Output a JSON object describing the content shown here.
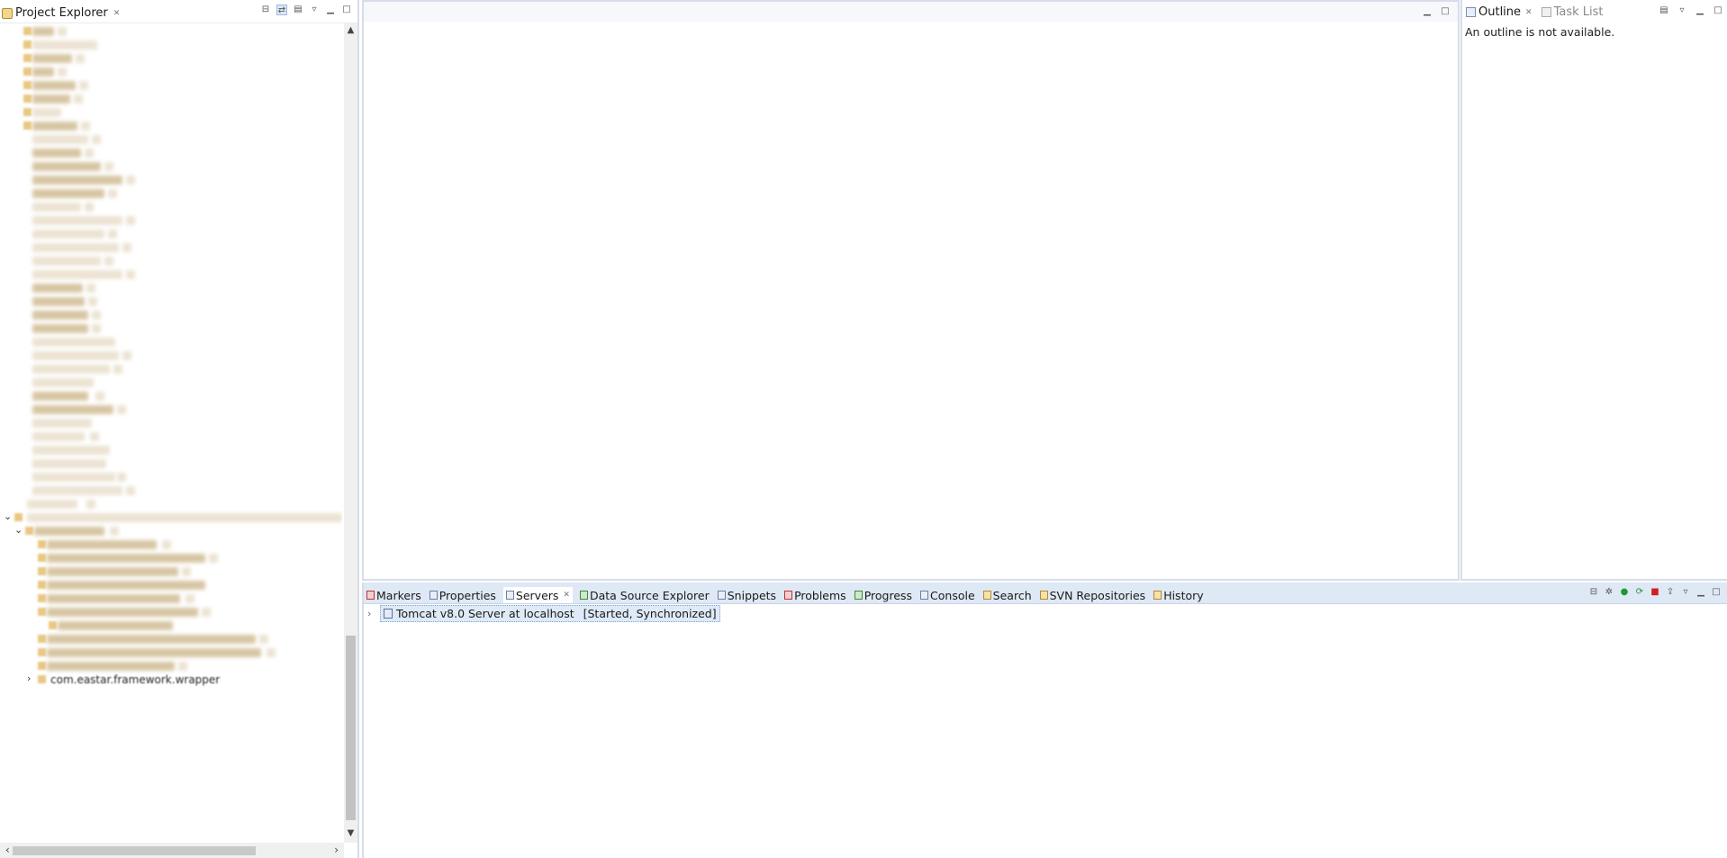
{
  "project_explorer": {
    "tab_label": "Project Explorer",
    "tree_partial_visible_text": "com.eastar.framework.wrapper"
  },
  "outline": {
    "tabs": [
      {
        "label": "Outline",
        "active": true
      },
      {
        "label": "Task List",
        "active": false
      }
    ],
    "message": "An outline is not available."
  },
  "bottom_views": {
    "tabs": [
      {
        "label": "Markers",
        "icon": "markers-icon",
        "active": false
      },
      {
        "label": "Properties",
        "icon": "properties-icon",
        "active": false
      },
      {
        "label": "Servers",
        "icon": "servers-icon",
        "active": true
      },
      {
        "label": "Data Source Explorer",
        "icon": "data-source-icon",
        "active": false
      },
      {
        "label": "Snippets",
        "icon": "snippets-icon",
        "active": false
      },
      {
        "label": "Problems",
        "icon": "problems-icon",
        "active": false
      },
      {
        "label": "Progress",
        "icon": "progress-icon",
        "active": false
      },
      {
        "label": "Console",
        "icon": "console-icon",
        "active": false
      },
      {
        "label": "Search",
        "icon": "search-icon",
        "active": false
      },
      {
        "label": "SVN Repositories",
        "icon": "svn-icon",
        "active": false
      },
      {
        "label": "History",
        "icon": "history-icon",
        "active": false
      }
    ],
    "servers": [
      {
        "name": "Tomcat v8.0 Server at localhost",
        "status": "[Started, Synchronized]"
      }
    ]
  },
  "colors": {
    "border": "#d6dde9",
    "bottom_tabbar": "#dfe8f5",
    "selection": "#dfeaf8",
    "start_button": "#1c9a2e",
    "stop_button": "#d12020"
  }
}
